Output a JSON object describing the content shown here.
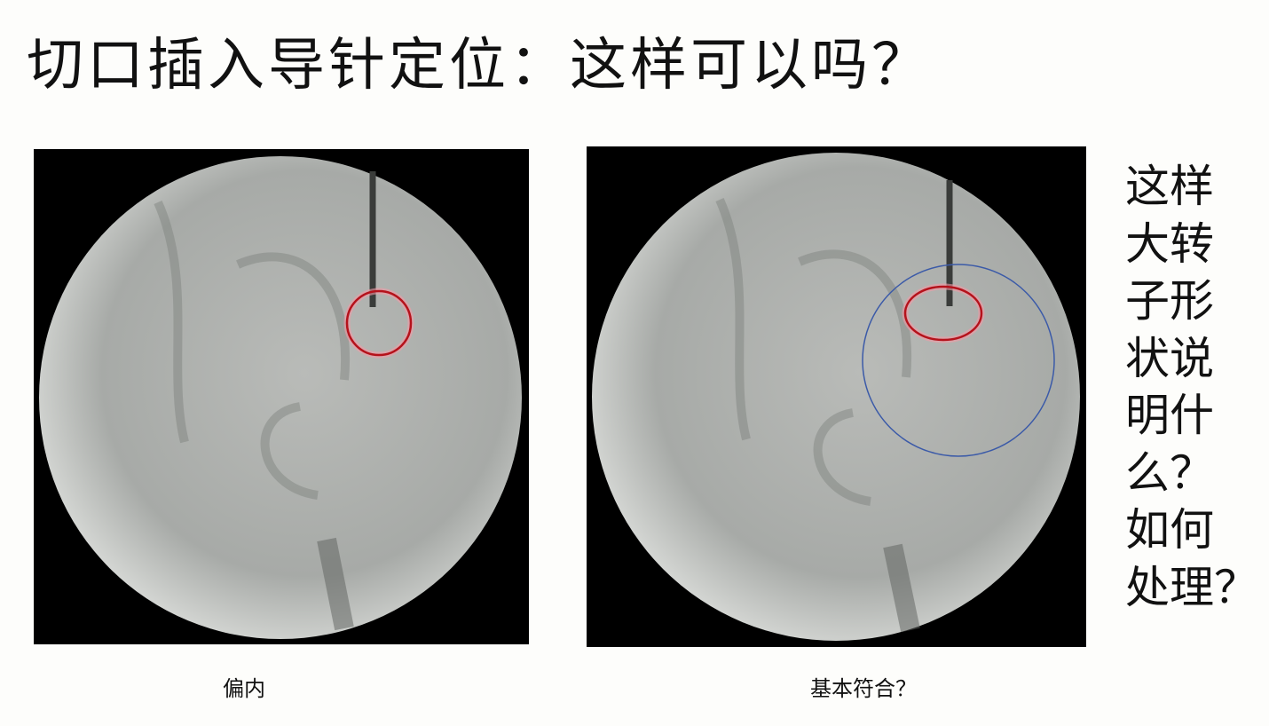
{
  "slide": {
    "title": "切口插入导针定位：这样可以吗？",
    "side_question": [
      "这样",
      "大转",
      "子形",
      "状说",
      "明什",
      "么？",
      "如何",
      "处理？"
    ],
    "images": [
      {
        "caption": "偏内",
        "annotation_colors": [
          "#c8102e"
        ]
      },
      {
        "caption": "基本符合？",
        "annotation_colors": [
          "#c8102e",
          "#3b5aa8"
        ]
      }
    ]
  }
}
